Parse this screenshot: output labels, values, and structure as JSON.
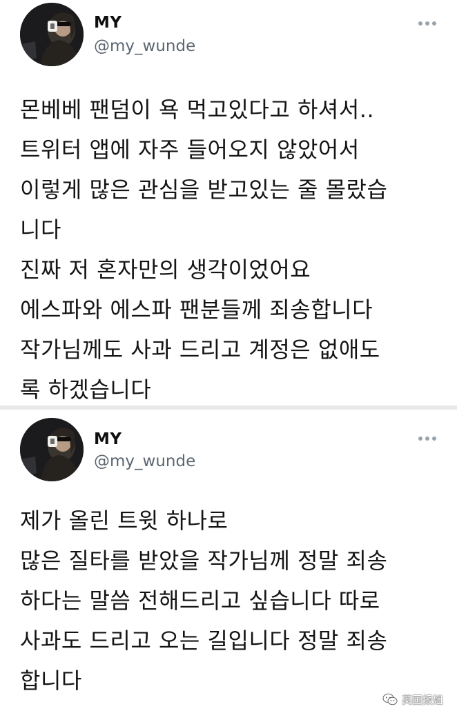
{
  "tweets": [
    {
      "author": {
        "display_name": "MY",
        "handle": "@my_wunde"
      },
      "more_icon": "more-horizontal-icon",
      "lines": [
        "몬베베 팬덤이 욕 먹고있다고 하셔서..",
        "트위터 앱에 자주 들어오지 않았어서",
        "이렇게 많은 관심을 받고있는 줄 몰랐습",
        "니다",
        "진짜 저 혼자만의 생각이었어요",
        "에스파와 에스파 팬분들께 죄송합니다",
        "작가님께도 사과 드리고 계정은 없애도",
        "록 하겠습니다"
      ]
    },
    {
      "author": {
        "display_name": "MY",
        "handle": "@my_wunde"
      },
      "more_icon": "more-horizontal-icon",
      "lines": [
        "제가 올린 트윗 하나로",
        "많은 질타를 받았을 작가님께 정말 죄송",
        "하다는 말씀 전해드리고 싶습니다 따로",
        "사과도 드리고 오는 길입니다 정말 죄송",
        "합니다"
      ]
    }
  ],
  "watermark": {
    "icon": "wechat-icon",
    "text": "英国报姐"
  },
  "colors": {
    "background": "#ffffff",
    "text": "#141414",
    "handle": "#5b6670",
    "separator": "#e9e9ec",
    "more_icon": "#9aa3ab"
  }
}
